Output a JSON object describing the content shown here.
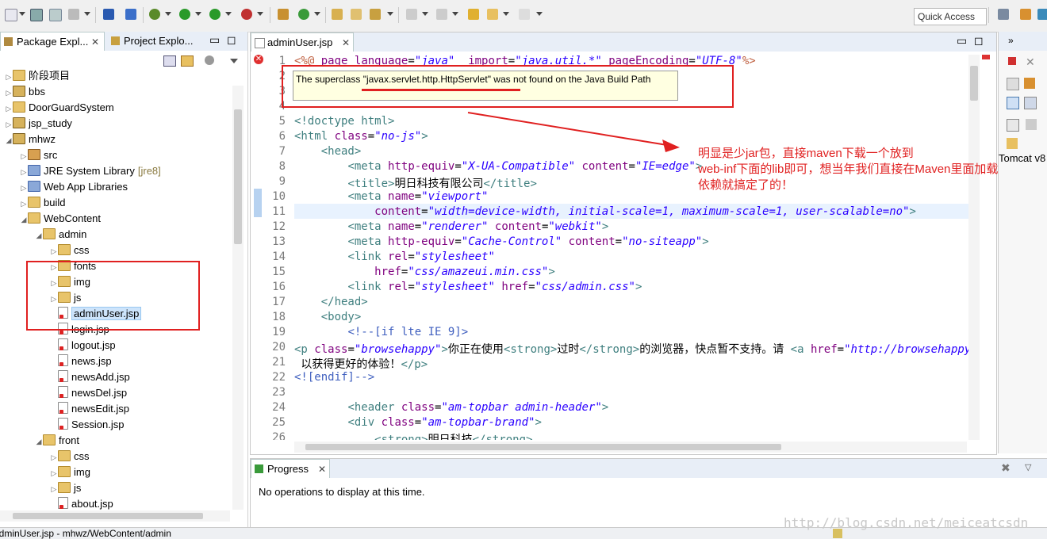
{
  "toolbar": {
    "quick_access": "Quick Access"
  },
  "left_panel": {
    "tabs": [
      {
        "label": "Package Expl..."
      },
      {
        "label": "Project Explo..."
      }
    ],
    "tree": [
      {
        "label": "阶段项目",
        "type": "folder",
        "indent": 0
      },
      {
        "label": "bbs",
        "type": "proj",
        "indent": 0
      },
      {
        "label": "DoorGuardSystem",
        "type": "folder",
        "indent": 0
      },
      {
        "label": "jsp_study",
        "type": "proj",
        "indent": 0
      },
      {
        "label": "mhwz",
        "type": "proj",
        "indent": 0
      },
      {
        "label": "src",
        "type": "pkg",
        "indent": 1
      },
      {
        "label": "JRE System Library",
        "suffix": "[jre8]",
        "type": "lib",
        "indent": 1
      },
      {
        "label": "Web App Libraries",
        "type": "lib",
        "indent": 1
      },
      {
        "label": "build",
        "type": "folder",
        "indent": 1
      },
      {
        "label": "WebContent",
        "type": "folder",
        "indent": 1
      },
      {
        "label": "admin",
        "type": "folder",
        "indent": 2
      },
      {
        "label": "css",
        "type": "folder",
        "indent": 3
      },
      {
        "label": "fonts",
        "type": "folder",
        "indent": 3
      },
      {
        "label": "img",
        "type": "folder",
        "indent": 3
      },
      {
        "label": "js",
        "type": "folder",
        "indent": 3
      },
      {
        "label": "adminUser.jsp",
        "type": "file",
        "indent": 3,
        "selected": true
      },
      {
        "label": "login.jsp",
        "type": "file",
        "indent": 3
      },
      {
        "label": "logout.jsp",
        "type": "file",
        "indent": 3
      },
      {
        "label": "news.jsp",
        "type": "file",
        "indent": 3
      },
      {
        "label": "newsAdd.jsp",
        "type": "file",
        "indent": 3
      },
      {
        "label": "newsDel.jsp",
        "type": "file",
        "indent": 3
      },
      {
        "label": "newsEdit.jsp",
        "type": "file",
        "indent": 3
      },
      {
        "label": "Session.jsp",
        "type": "file",
        "indent": 3
      },
      {
        "label": "front",
        "type": "folder",
        "indent": 2
      },
      {
        "label": "css",
        "type": "folder",
        "indent": 3
      },
      {
        "label": "img",
        "type": "folder",
        "indent": 3
      },
      {
        "label": "js",
        "type": "folder",
        "indent": 3
      },
      {
        "label": "about.jsp",
        "type": "file",
        "indent": 3
      }
    ]
  },
  "editor": {
    "tab_label": "adminUser.jsp",
    "tooltip": "The superclass \"javax.servlet.http.HttpServlet\" was not found on the Java Build Path",
    "lines": [
      {
        "n": "1",
        "html": "<span class='jsp'>&lt;%@</span> <span class='at'>page</span> <span class='at'>language</span>=<span class='st'>\"java\"</span>  <span class='at'>import</span>=<span class='st'>\"java.util.*\"</span> <span class='at'>pageEncoding</span>=<span class='st'>\"UTF-8\"</span><span class='jsp'>%&gt;</span>"
      },
      {
        "n": "2",
        "html": ""
      },
      {
        "n": "3",
        "html": ""
      },
      {
        "n": "4",
        "html": ""
      },
      {
        "n": "5",
        "html": "<span class='tg'>&lt;!doctype</span> <span class='tg'>html&gt;</span>"
      },
      {
        "n": "6",
        "html": "<span class='tg'>&lt;html</span> <span class='at'>class</span>=<span class='st'>\"no-js\"</span><span class='tg'>&gt;</span>"
      },
      {
        "n": "7",
        "html": "    <span class='tg'>&lt;head&gt;</span>"
      },
      {
        "n": "8",
        "html": "        <span class='tg'>&lt;meta</span> <span class='at'>http-equiv</span>=<span class='st'>\"X-UA-Compatible\"</span> <span class='at'>content</span>=<span class='st'>\"IE=edge\"</span><span class='tg'>&gt;</span>"
      },
      {
        "n": "9",
        "html": "        <span class='tg'>&lt;title&gt;</span>明日科技有限公司<span class='tg'>&lt;/title&gt;</span>"
      },
      {
        "n": "10",
        "html": "        <span class='tg'>&lt;meta</span> <span class='at'>name</span>=<span class='st'>\"viewport\"</span>"
      },
      {
        "n": "11",
        "html": "            <span class='at'>content</span>=<span class='st'>\"width=device-width, initial-scale=1, maximum-scale=1, user-scalable=no\"</span><span class='tg'>&gt;</span>"
      },
      {
        "n": "12",
        "html": "        <span class='tg'>&lt;meta</span> <span class='at'>name</span>=<span class='st'>\"renderer\"</span> <span class='at'>content</span>=<span class='st'>\"webkit\"</span><span class='tg'>&gt;</span>"
      },
      {
        "n": "13",
        "html": "        <span class='tg'>&lt;meta</span> <span class='at'>http-equiv</span>=<span class='st'>\"Cache-Control\"</span> <span class='at'>content</span>=<span class='st'>\"no-siteapp\"</span><span class='tg'>&gt;</span>"
      },
      {
        "n": "14",
        "html": "        <span class='tg'>&lt;link</span> <span class='at'>rel</span>=<span class='st'>\"stylesheet\"</span>"
      },
      {
        "n": "15",
        "html": "            <span class='at'>href</span>=<span class='st'>\"css/amazeui.min.css\"</span><span class='tg'>&gt;</span>"
      },
      {
        "n": "16",
        "html": "        <span class='tg'>&lt;link</span> <span class='at'>rel</span>=<span class='st'>\"stylesheet\"</span> <span class='at'>href</span>=<span class='st'>\"css/admin.css\"</span><span class='tg'>&gt;</span>"
      },
      {
        "n": "17",
        "html": "    <span class='tg'>&lt;/head&gt;</span>"
      },
      {
        "n": "18",
        "html": "    <span class='tg'>&lt;body&gt;</span>"
      },
      {
        "n": "19",
        "html": "        <span class='cm'>&lt;!--[if lte IE 9]&gt;</span>"
      },
      {
        "n": "20",
        "html": "<span class='tg'>&lt;p</span> <span class='at'>class</span>=<span class='st'>\"browsehappy\"</span><span class='tg'>&gt;</span>你正在使用<span class='tg'>&lt;strong&gt;</span>过时<span class='tg'>&lt;/strong&gt;</span>的浏览器，快点暂不支持。请 <span class='tg'>&lt;a</span> <span class='at'>href</span>=<span class='st'>\"http://browsehappy</span>"
      },
      {
        "n": "21",
        "html": " 以获得更好的体验！<span class='tg'>&lt;/p&gt;</span>"
      },
      {
        "n": "22",
        "html": "<span class='cm'>&lt;![endif]--&gt;</span>"
      },
      {
        "n": "23",
        "html": ""
      },
      {
        "n": "24",
        "html": "        <span class='tg'>&lt;header</span> <span class='at'>class</span>=<span class='st'>\"am-topbar admin-header\"</span><span class='tg'>&gt;</span>"
      },
      {
        "n": "25",
        "html": "        <span class='tg'>&lt;div</span> <span class='at'>class</span>=<span class='st'>\"am-topbar-brand\"</span><span class='tg'>&gt;</span>"
      },
      {
        "n": "26",
        "html": "            <span class='tg'>&lt;strong&gt;</span>明日科技<span class='tg'>&lt;/strong&gt;</span>"
      }
    ]
  },
  "annotation": {
    "line1": "明显是少jar包，直接maven下载一个放到",
    "line2": "web-inf下面的lib即可，想当年我们直接在Maven里面加载一个",
    "line3": "依赖就搞定了的！"
  },
  "right_panel": {
    "tomcat_label": "Tomcat v8"
  },
  "bottom": {
    "tab_label": "Progress",
    "message": "No operations to display at this time."
  },
  "status_bar": {
    "path": "adminUser.jsp - mhwz/WebContent/admin"
  },
  "watermark": "http://blog.csdn.net/meiceatcsdn",
  "colors": {
    "annotation_red": "#e02020",
    "editor_bg": "#ffffff",
    "panel_tab_bg": "#e8eef7"
  }
}
